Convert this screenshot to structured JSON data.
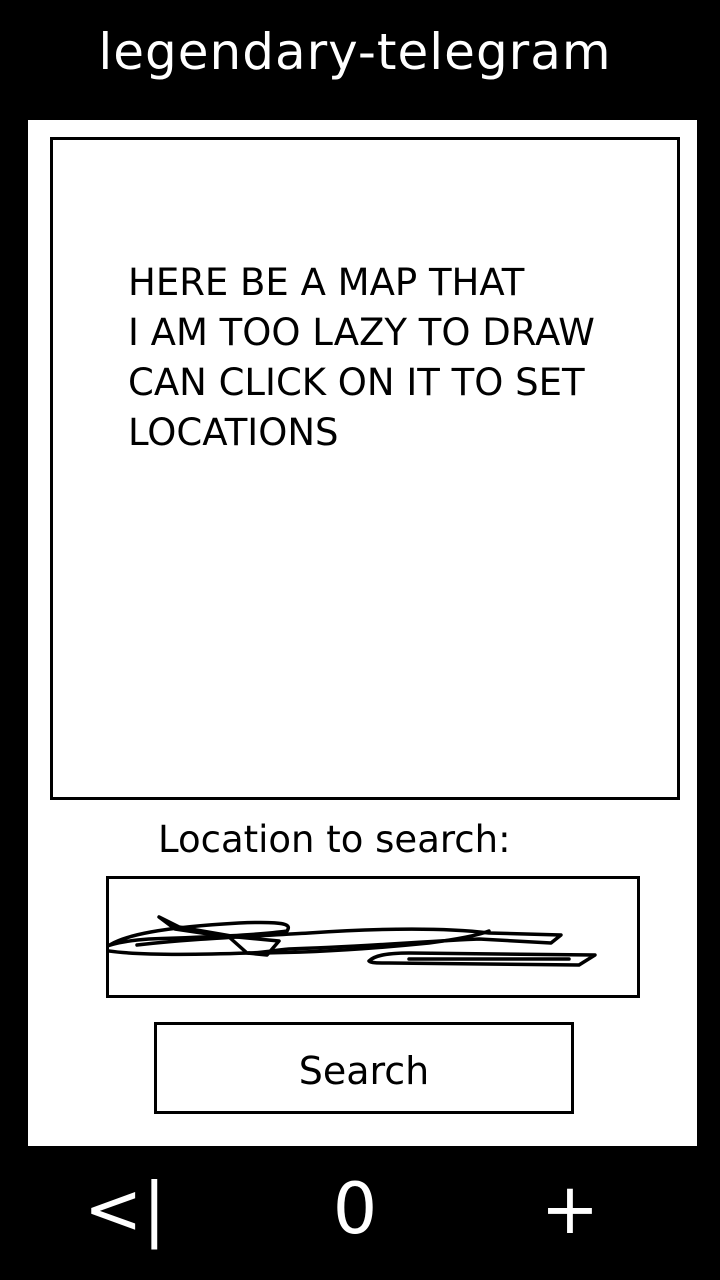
{
  "header": {
    "title": "legendary-telegram"
  },
  "map": {
    "placeholder_lines": [
      "HERE BE A MAP THAT",
      "I AM TOO LAZY TO DRAW",
      "CAN CLICK ON IT TO SET",
      "LOCATIONS"
    ]
  },
  "search": {
    "label": "Location to search:",
    "button_label": "Search",
    "input_icon": "scribble-text-icon"
  },
  "bottom_nav": {
    "back_label": "<|",
    "zero_label": "0",
    "add_label": "+"
  },
  "colors": {
    "background": "#000000",
    "panel": "#ffffff",
    "text_dark": "#000000",
    "text_light": "#ffffff"
  }
}
